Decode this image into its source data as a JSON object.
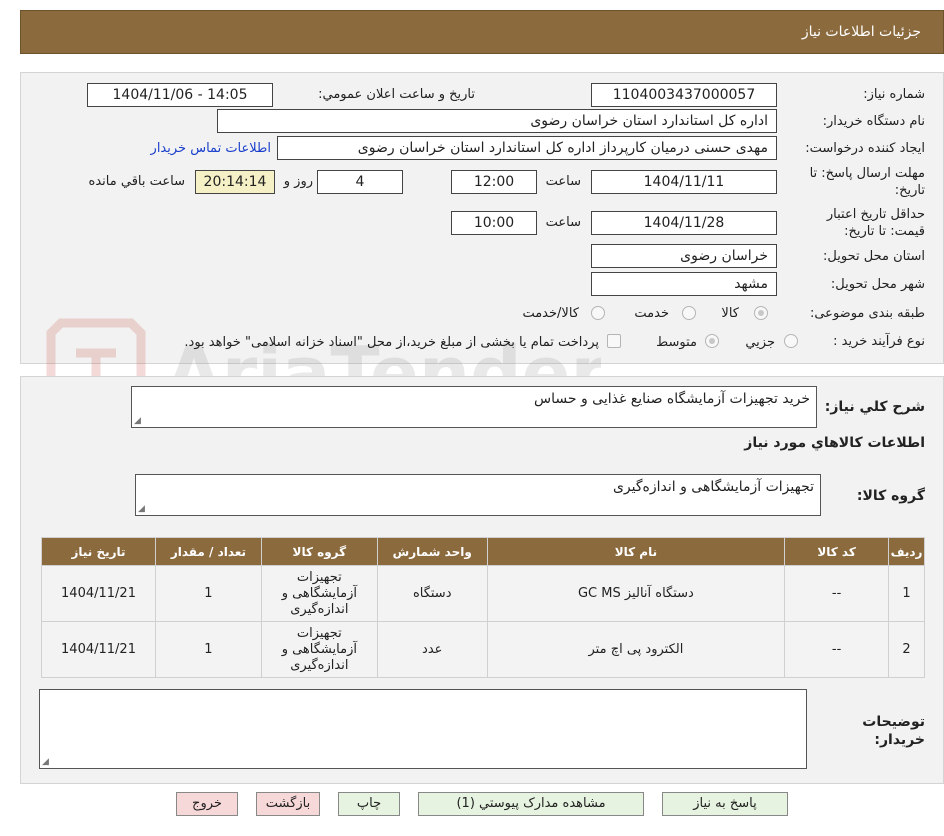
{
  "header": {
    "title": "جزئيات اطلاعات نياز"
  },
  "labels": {
    "need_number": "شماره نياز:",
    "announce_datetime": "تاريخ و ساعت اعلان عمومي:",
    "buyer_org": "نام دستگاه خريدار:",
    "requester": "ايجاد كننده درخواست:",
    "send_deadline": "مهلت ارسال پاسخ: تا تاريخ:",
    "time": "ساعت",
    "days_and": "روز و",
    "remaining": "ساعت باقي مانده",
    "price_validity": "حداقل تاريخ اعتبار قيمت: تا تاريخ:",
    "province": "استان محل تحويل:",
    "city": "شهر محل تحويل:",
    "category": "طبقه بندی موضوعی:",
    "purchase_type": "نوع فرآيند خريد :",
    "summary": "شرح كلي نياز:",
    "goods_info": "اطلاعات كالاهاي مورد نياز",
    "goods_group": "گروه كالا:",
    "buyer_notes": "توضيحات خريدار:"
  },
  "form": {
    "need_number": "1104003437000057",
    "announce_datetime": "1404/11/06 - 14:05",
    "buyer_org": "اداره کل استاندارد استان خراسان رضوی",
    "requester": "مهدی حسنی درمیان کارپرداز اداره کل استاندارد استان خراسان رضوی",
    "contact_link": "اطلاعات تماس خريدار",
    "send_date": "1404/11/11",
    "send_time": "12:00",
    "days": "4",
    "remaining_time": "20:14:14",
    "validity_date": "1404/11/28",
    "validity_time": "10:00",
    "province": "خراسان رضوی",
    "city": "مشهد",
    "category_options": [
      "كالا",
      "خدمت",
      "كالا/خدمت"
    ],
    "purchase_options": [
      "جزيي",
      "متوسط"
    ],
    "payment_note": "پرداخت تمام يا بخشی از مبلغ خريد،از محل \"اسناد خزانه اسلامی\" خواهد بود.",
    "summary": "خرید تجهیزات آزمایشگاه صنایع غذایی و حساس",
    "goods_group": "تجهیزات آزمایشگاهی و اندازه‌گیری",
    "buyer_notes": ""
  },
  "table": {
    "headers": [
      "رديف",
      "كد كالا",
      "نام كالا",
      "واحد شمارش",
      "گروه كالا",
      "تعداد / مقدار",
      "تاريخ نياز"
    ],
    "rows": [
      {
        "row": "1",
        "code": "--",
        "name": "دستگاه آنالیز GC MS",
        "unit": "دستگاه",
        "group": "تجهیزات آزمایشگاهی و اندازه‌گیری",
        "qty": "1",
        "date": "1404/11/21"
      },
      {
        "row": "2",
        "code": "--",
        "name": "الکترود پی اچ متر",
        "unit": "عدد",
        "group": "تجهیزات آزمایشگاهی و اندازه‌گیری",
        "qty": "1",
        "date": "1404/11/21"
      }
    ]
  },
  "buttons": {
    "reply": "پاسخ به نياز",
    "attachments": "مشاهده مدارک پيوستي (1)",
    "print": "چاپ",
    "back": "بازگشت",
    "exit": "خروج"
  },
  "colors": {
    "header": "#8b6a3e",
    "panel": "#f2f2f2",
    "link": "#1a3fcc"
  }
}
